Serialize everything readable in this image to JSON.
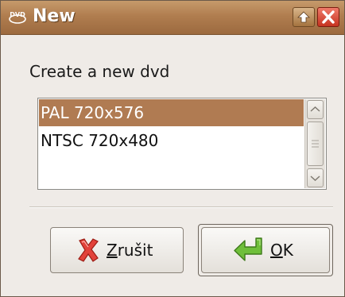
{
  "window": {
    "title": "New",
    "title_icon": "dvd-icon",
    "maximize_icon": "arrow-up-icon",
    "close_icon": "close-x-icon"
  },
  "dialog": {
    "prompt": "Create a new dvd",
    "formats": [
      {
        "label": "PAL 720x576",
        "selected": true
      },
      {
        "label": "NTSC 720x480",
        "selected": false
      }
    ]
  },
  "buttons": {
    "cancel": {
      "mnemonic": "Z",
      "rest": "rušit",
      "icon": "cancel-x-icon"
    },
    "ok": {
      "mnemonic": "O",
      "rest": "K",
      "icon": "enter-arrow-icon"
    }
  },
  "colors": {
    "titlebar": "#b07d4f",
    "selection": "#b07b52",
    "window_bg": "#efebe7",
    "close_button": "#c6321f"
  }
}
